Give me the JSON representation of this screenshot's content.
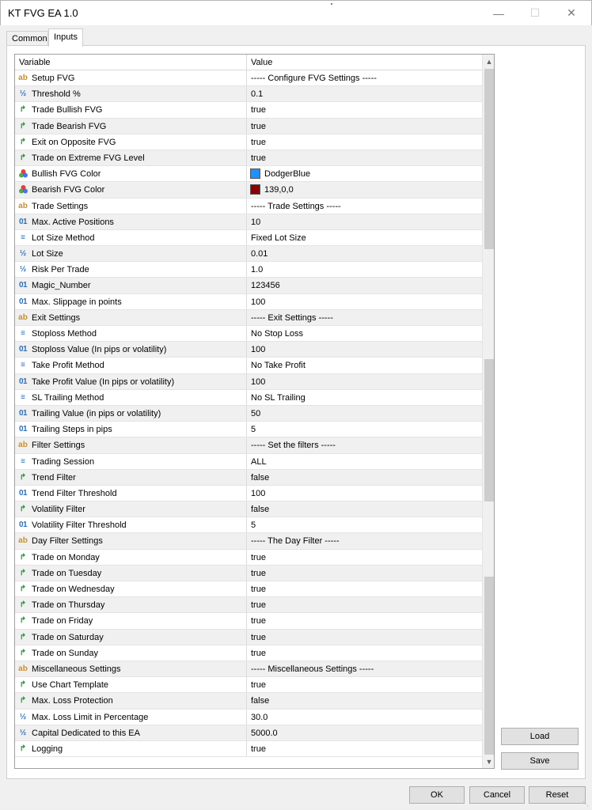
{
  "window": {
    "title": "KT FVG EA 1.0"
  },
  "tabs": [
    {
      "label": "Common"
    },
    {
      "label": "Inputs"
    }
  ],
  "grid": {
    "col_variable": "Variable",
    "col_value": "Value",
    "rows": [
      {
        "icon": "string-icon",
        "name": "Setup FVG",
        "value": "----- Configure FVG Settings -----"
      },
      {
        "icon": "double-icon",
        "name": "Threshold %",
        "value": "0.1"
      },
      {
        "icon": "bool-icon",
        "name": "Trade Bullish FVG",
        "value": "true"
      },
      {
        "icon": "bool-icon",
        "name": "Trade Bearish FVG",
        "value": "true"
      },
      {
        "icon": "bool-icon",
        "name": "Exit on Opposite FVG",
        "value": "true"
      },
      {
        "icon": "bool-icon",
        "name": "Trade on Extreme FVG Level",
        "value": "true"
      },
      {
        "icon": "color-icon",
        "name": "Bullish FVG Color",
        "value": "DodgerBlue",
        "swatch": "#1e90ff"
      },
      {
        "icon": "color-icon",
        "name": "Bearish FVG Color",
        "value": "139,0,0",
        "swatch": "#8b0000"
      },
      {
        "icon": "string-icon",
        "name": "Trade Settings",
        "value": "----- Trade Settings -----"
      },
      {
        "icon": "int-icon",
        "name": "Max. Active Positions",
        "value": "10"
      },
      {
        "icon": "enum-icon",
        "name": "Lot Size Method",
        "value": "Fixed Lot Size"
      },
      {
        "icon": "double-icon",
        "name": "Lot Size",
        "value": "0.01"
      },
      {
        "icon": "double-icon",
        "name": "Risk Per Trade",
        "value": "1.0"
      },
      {
        "icon": "int-icon",
        "name": "Magic_Number",
        "value": "123456"
      },
      {
        "icon": "int-icon",
        "name": "Max. Slippage in points",
        "value": "100"
      },
      {
        "icon": "string-icon",
        "name": "Exit Settings",
        "value": "----- Exit Settings -----"
      },
      {
        "icon": "enum-icon",
        "name": "Stoploss Method",
        "value": "No Stop Loss"
      },
      {
        "icon": "int-icon",
        "name": "Stoploss Value (In pips or volatility)",
        "value": "100"
      },
      {
        "icon": "enum-icon",
        "name": "Take Profit Method",
        "value": "No Take Profit"
      },
      {
        "icon": "int-icon",
        "name": "Take Profit Value (In pips or volatility)",
        "value": "100"
      },
      {
        "icon": "enum-icon",
        "name": "SL Trailing Method",
        "value": "No SL Trailing"
      },
      {
        "icon": "int-icon",
        "name": "Trailing Value (in pips or volatility)",
        "value": "50"
      },
      {
        "icon": "int-icon",
        "name": "Trailing Steps in pips",
        "value": "5"
      },
      {
        "icon": "string-icon",
        "name": "Filter Settings",
        "value": "----- Set the filters -----"
      },
      {
        "icon": "enum-icon",
        "name": "Trading Session",
        "value": "ALL"
      },
      {
        "icon": "bool-icon",
        "name": "Trend Filter",
        "value": "false"
      },
      {
        "icon": "int-icon",
        "name": "Trend Filter Threshold",
        "value": "100"
      },
      {
        "icon": "bool-icon",
        "name": "Volatility Filter",
        "value": "false"
      },
      {
        "icon": "int-icon",
        "name": "Volatility Filter Threshold",
        "value": "5"
      },
      {
        "icon": "string-icon",
        "name": "Day Filter Settings",
        "value": "----- The Day Filter -----"
      },
      {
        "icon": "bool-icon",
        "name": "Trade on Monday",
        "value": "true"
      },
      {
        "icon": "bool-icon",
        "name": "Trade on Tuesday",
        "value": "true"
      },
      {
        "icon": "bool-icon",
        "name": "Trade on Wednesday",
        "value": "true"
      },
      {
        "icon": "bool-icon",
        "name": "Trade on Thursday",
        "value": "true"
      },
      {
        "icon": "bool-icon",
        "name": "Trade on Friday",
        "value": "true"
      },
      {
        "icon": "bool-icon",
        "name": "Trade on Saturday",
        "value": "true"
      },
      {
        "icon": "bool-icon",
        "name": "Trade on Sunday",
        "value": "true"
      },
      {
        "icon": "string-icon",
        "name": "Miscellaneous Settings",
        "value": "----- Miscellaneous Settings -----"
      },
      {
        "icon": "bool-icon",
        "name": "Use Chart Template",
        "value": "true"
      },
      {
        "icon": "bool-icon",
        "name": "Max. Loss Protection",
        "value": "false"
      },
      {
        "icon": "double-icon",
        "name": "Max. Loss Limit in Percentage",
        "value": "30.0"
      },
      {
        "icon": "double-icon",
        "name": "Capital Dedicated to this EA",
        "value": "5000.0"
      },
      {
        "icon": "bool-icon",
        "name": "Logging",
        "value": "true"
      }
    ]
  },
  "side_buttons": {
    "load": "Load",
    "save": "Save"
  },
  "footer_buttons": {
    "ok": "OK",
    "cancel": "Cancel",
    "reset": "Reset"
  }
}
